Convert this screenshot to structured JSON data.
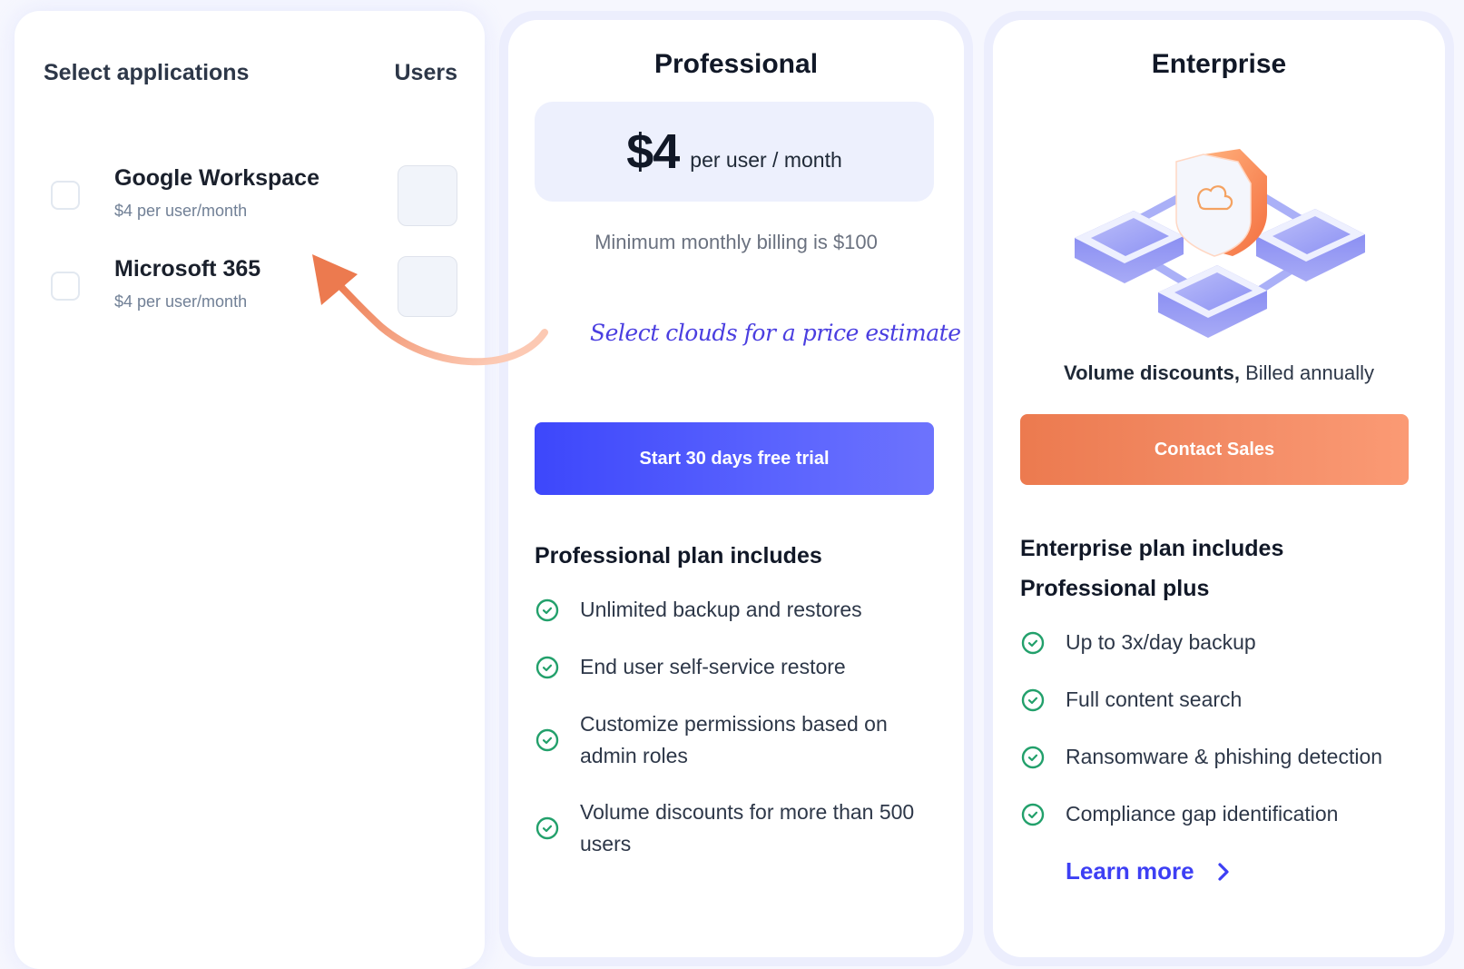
{
  "selector": {
    "heading": "Select applications",
    "users_heading": "Users",
    "apps": [
      {
        "name": "Google Workspace",
        "price": "$4 per user/month",
        "checked": false,
        "users_value": ""
      },
      {
        "name": "Microsoft 365",
        "price": "$4 per user/month",
        "checked": false,
        "users_value": ""
      }
    ]
  },
  "hint": {
    "text": "Select clouds for a price estimate",
    "color": "#4a3ee0",
    "arrow_color": "#ec7a4f"
  },
  "professional": {
    "title": "Professional",
    "price": "$4",
    "price_unit": "per user / month",
    "min_billing": "Minimum monthly billing is $100",
    "cta": "Start 30 days free trial",
    "cta_color": "#3d47fb",
    "includes_title": "Professional plan includes",
    "features": [
      "Unlimited backup and restores",
      "End user self-service restore",
      "Customize permissions based on admin roles",
      "Volume discounts for more than 500 users"
    ]
  },
  "enterprise": {
    "title": "Enterprise",
    "illustration": "shield-network-illustration",
    "volume_bold": "Volume discounts,",
    "volume_rest": " Billed annually",
    "cta": "Contact Sales",
    "cta_color": "#ec7a4f",
    "includes_title": "Enterprise plan includes",
    "includes_subtitle": "Professional plus",
    "features": [
      "Up to 3x/day backup",
      "Full content search",
      "Ransomware & phishing detection",
      "Compliance gap identification"
    ],
    "learn_more": "Learn more"
  },
  "icons": {
    "feature_check": "check-circle-icon",
    "learn_more": "chevron-right-icon"
  },
  "colors": {
    "check_green": "#22a06b",
    "link_blue": "#3d3ff4"
  }
}
